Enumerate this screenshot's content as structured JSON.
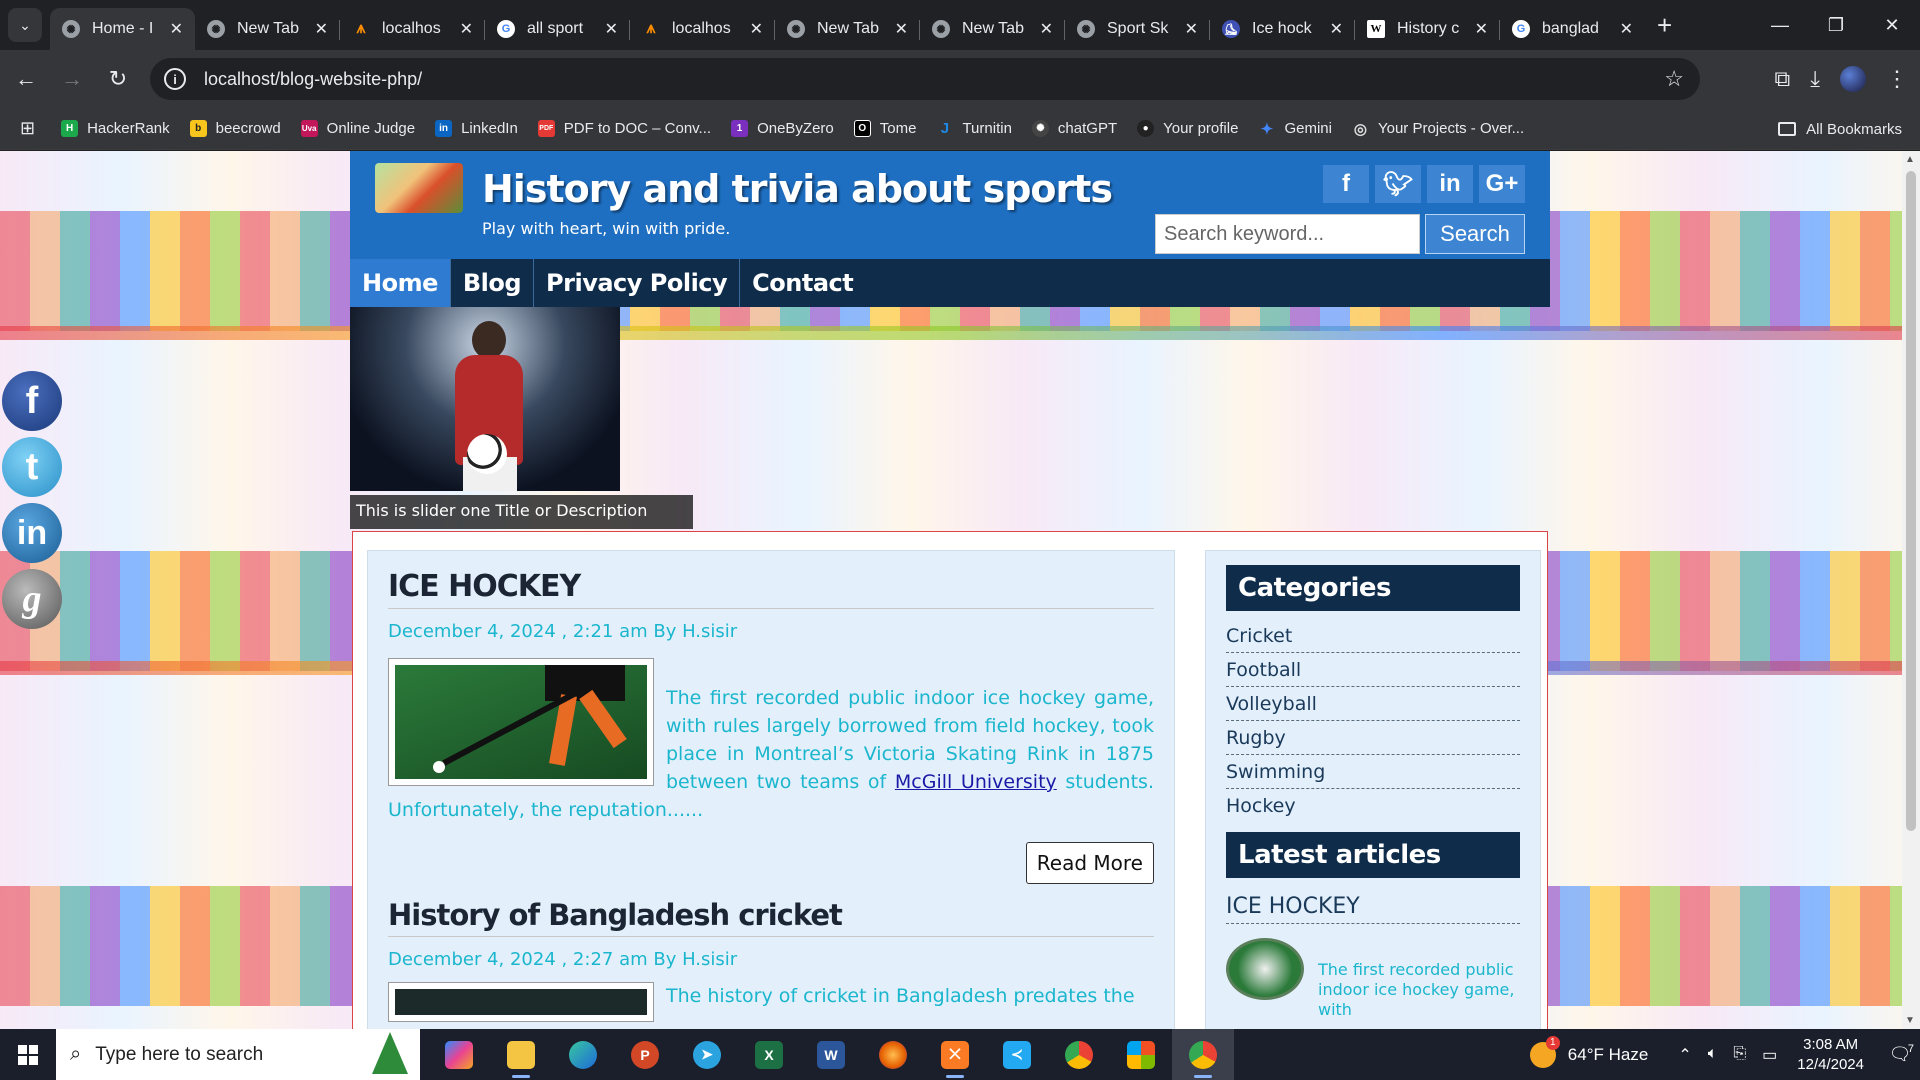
{
  "browser": {
    "tabs": [
      {
        "title": "Home - I",
        "active": true,
        "icon": "chatgpt-icon"
      },
      {
        "title": "New Tab",
        "icon": "chatgpt-icon"
      },
      {
        "title": "localhos",
        "icon": "xampp-icon"
      },
      {
        "title": "all sport",
        "icon": "google-icon"
      },
      {
        "title": "localhos",
        "icon": "xampp-icon"
      },
      {
        "title": "New Tab",
        "icon": "chatgpt-icon"
      },
      {
        "title": "New Tab",
        "icon": "chatgpt-icon"
      },
      {
        "title": "Sport Sk",
        "icon": "chatgpt-icon"
      },
      {
        "title": "Ice hock",
        "icon": "ice-hockey-icon"
      },
      {
        "title": "History c",
        "icon": "wikipedia-icon"
      },
      {
        "title": "banglad",
        "icon": "google-icon"
      }
    ],
    "url": "localhost/blog-website-php/",
    "bookmarks": [
      {
        "label": "HackerRank",
        "color": "#1ba94c",
        "glyph": "H"
      },
      {
        "label": "beecrowd",
        "color": "#f7c51b",
        "glyph": "b"
      },
      {
        "label": "Online Judge",
        "color": "#c2185b",
        "glyph": "Uva"
      },
      {
        "label": "LinkedIn",
        "color": "#0a66c2",
        "glyph": "in"
      },
      {
        "label": "PDF to DOC – Conv...",
        "color": "#e53935",
        "glyph": "PDF"
      },
      {
        "label": "OneByZero",
        "color": "#7b2fbf",
        "glyph": "1"
      },
      {
        "label": "Tome",
        "color": "#000000",
        "glyph": "O"
      },
      {
        "label": "Turnitin",
        "color": "#1976d2",
        "glyph": "J"
      },
      {
        "label": "chatGPT",
        "color": "#444444",
        "glyph": "G"
      },
      {
        "label": "Your profile",
        "color": "#222222",
        "glyph": "●"
      },
      {
        "label": "Gemini",
        "color": "#4285f4",
        "glyph": "✦"
      },
      {
        "label": "Your Projects - Over...",
        "color": "#555555",
        "glyph": "◎"
      }
    ],
    "all_bookmarks": "All Bookmarks"
  },
  "site": {
    "title": "History and trivia about sports",
    "tagline": "Play with heart, win with pride.",
    "search_placeholder": "Search keyword...",
    "search_button": "Search",
    "social": [
      "f",
      "t",
      "in",
      "G+"
    ],
    "nav": [
      "Home",
      "Blog",
      "Privacy Policy",
      "Contact"
    ],
    "slider_caption": "This is slider one Title or Description",
    "posts": [
      {
        "title": "ICE HOCKEY",
        "meta": "December 4, 2024 , 2:21 am By H.sisir",
        "text_before": "The first recorded public indoor ice hockey game, with rules largely borrowed from field hockey, took place in Montreal’s Victoria Skating Rink in 1875 between two teams of ",
        "link": "McGill University",
        "text_after": " students. Unfortunately, the reputation......",
        "read_more": "Read More"
      },
      {
        "title": "History of Bangladesh cricket",
        "meta": "December 4, 2024 , 2:27 am By H.sisir",
        "text": "The history of cricket in Bangladesh predates the"
      }
    ],
    "sidebar": {
      "categories_title": "Categories",
      "categories": [
        "Cricket",
        "Football",
        "Volleyball",
        "Rugby",
        "Swimming",
        "Hockey"
      ],
      "latest_title": "Latest articles",
      "latest_item_title": "ICE HOCKEY",
      "latest_item_text": "The first recorded public indoor ice hockey game, with"
    }
  },
  "taskbar": {
    "search_placeholder": "Type here to search",
    "weather": "64°F  Haze",
    "weather_badge": "1",
    "time": "3:08 AM",
    "date": "12/4/2024",
    "notifications": "7"
  }
}
